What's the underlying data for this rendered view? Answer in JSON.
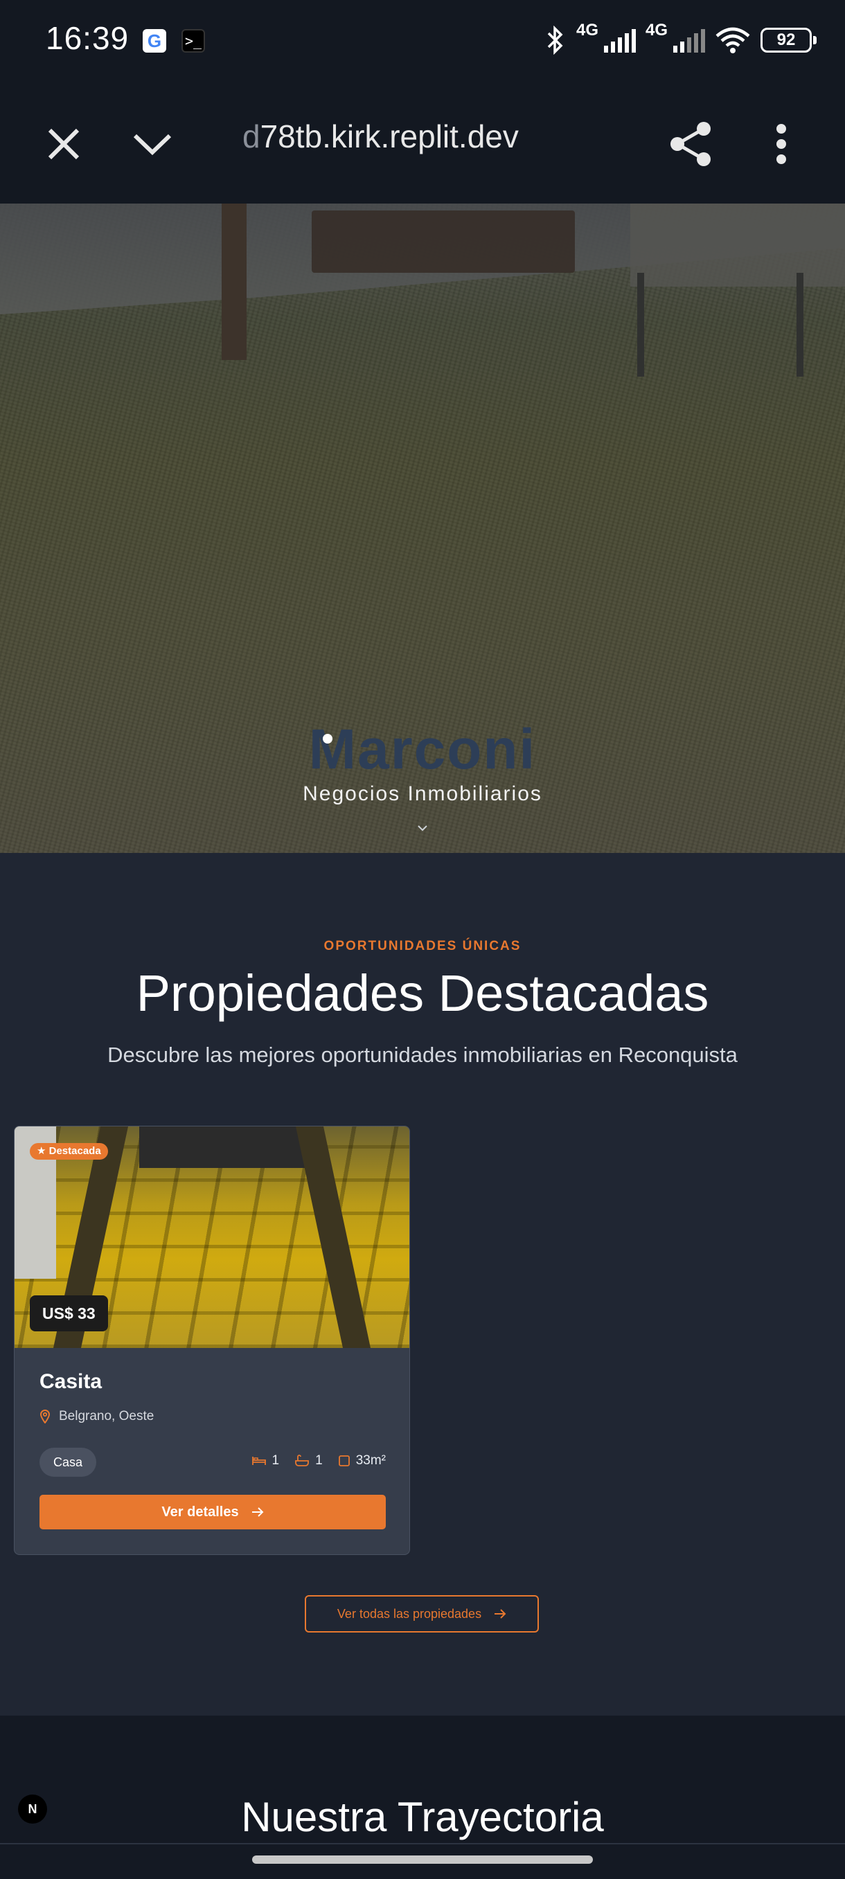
{
  "status_bar": {
    "time": "16:39",
    "network_1": "4G",
    "network_2": "4G",
    "battery": "92",
    "icons": [
      "google-icon",
      "terminal-icon",
      "bluetooth-icon",
      "signal-icon",
      "wifi-icon",
      "battery-icon"
    ]
  },
  "browser": {
    "url_fade": "d",
    "url_rest": "78tb.kirk.replit.dev",
    "icons": [
      "close-icon",
      "chevron-down-icon",
      "share-icon",
      "more-vert-icon"
    ]
  },
  "hero": {
    "brand": "Marconi",
    "tagline": "Negocios Inmobiliarios"
  },
  "featured": {
    "eyebrow": "OPORTUNIDADES ÚNICAS",
    "title": "Propiedades Destacadas",
    "subtitle": "Descubre las mejores oportunidades inmobiliarias en Reconquista",
    "cards": [
      {
        "badge": "Destacada",
        "price": "US$ 33",
        "name": "Casita",
        "location": "Belgrano, Oeste",
        "type": "Casa",
        "bedrooms": "1",
        "bathrooms": "1",
        "area": "33m²",
        "button": "Ver detalles"
      }
    ],
    "all_button": "Ver todas las propiedades"
  },
  "history": {
    "title": "Nuestra Trayectoria"
  },
  "dev_badge": "N",
  "colors": {
    "accent": "#e8782f",
    "section_bg": "#202633",
    "card_bg": "#363d4b",
    "bar_bg": "#131821"
  }
}
